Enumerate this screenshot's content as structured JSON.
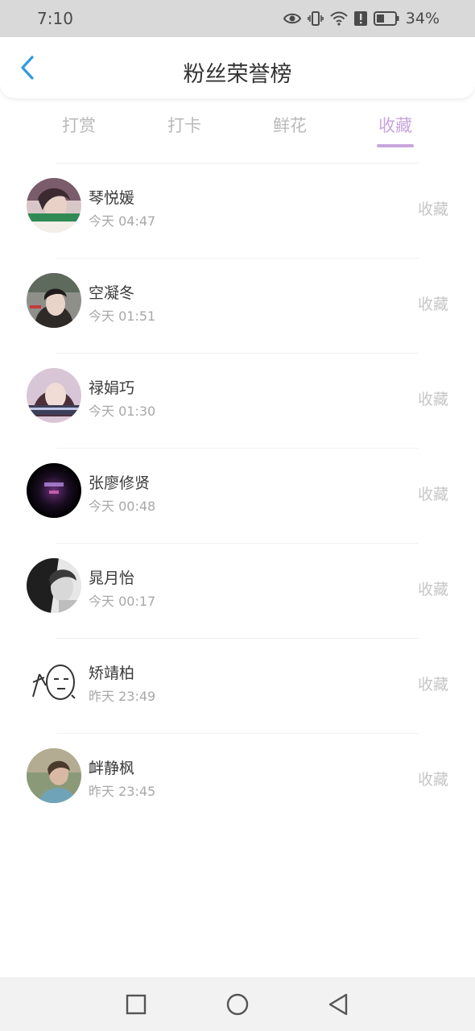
{
  "status_bar": {
    "time": "7:10",
    "battery_text": "34%",
    "icons": [
      "eye-icon",
      "vibrate-icon",
      "wifi-icon",
      "alert-icon",
      "battery-icon"
    ]
  },
  "header": {
    "title": "粉丝荣誉榜",
    "back_icon": "chevron-left-icon",
    "accent_color": "#2f9be0"
  },
  "tabs": [
    {
      "label": "打赏",
      "active": false
    },
    {
      "label": "打卡",
      "active": false
    },
    {
      "label": "鲜花",
      "active": false
    },
    {
      "label": "收藏",
      "active": true
    }
  ],
  "tab_active_color": "#c8a6dd",
  "list": [
    {
      "name": "琴悦媛",
      "time": "今天 04:47",
      "action": "收藏"
    },
    {
      "name": "空凝冬",
      "time": "今天 01:51",
      "action": "收藏"
    },
    {
      "name": "禄娟巧",
      "time": "今天 01:30",
      "action": "收藏"
    },
    {
      "name": "张廖修贤",
      "time": "今天 00:48",
      "action": "收藏"
    },
    {
      "name": "晁月怡",
      "time": "今天 00:17",
      "action": "收藏"
    },
    {
      "name": "矫靖柏",
      "time": "昨天 23:49",
      "action": "收藏"
    },
    {
      "name": "衅静枫",
      "time": "昨天 23:45",
      "action": "收藏"
    }
  ],
  "nav_bar": {
    "buttons": [
      "square-icon",
      "circle-icon",
      "triangle-back-icon"
    ]
  }
}
